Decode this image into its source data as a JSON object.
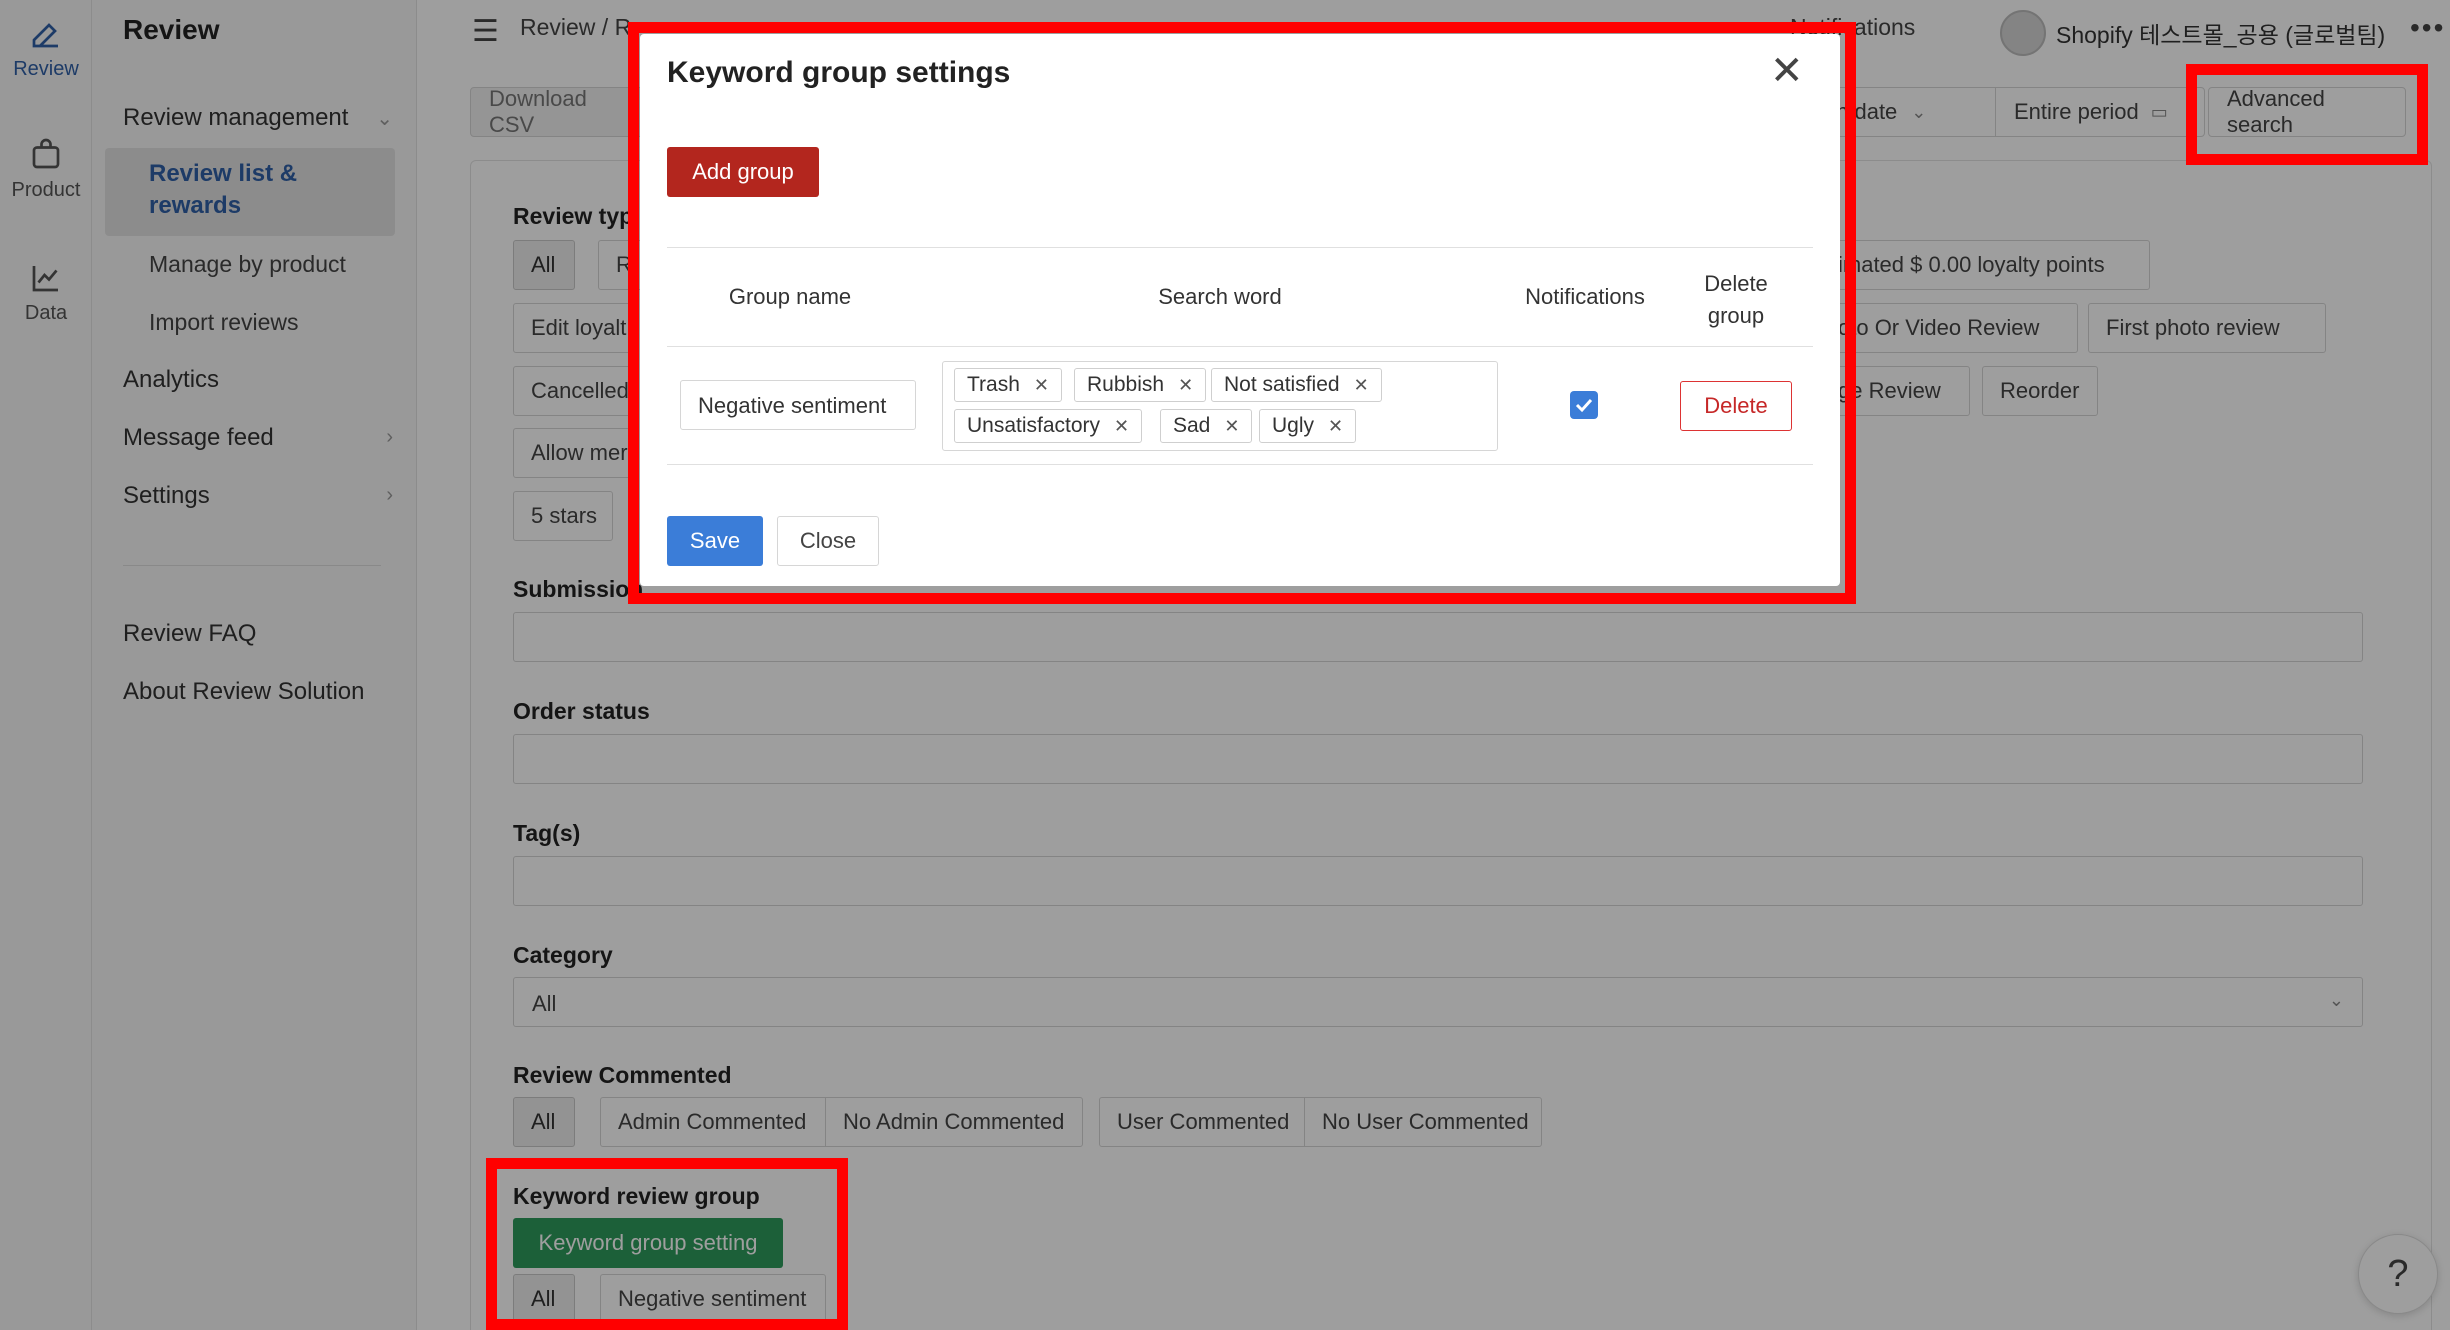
{
  "rail": {
    "items": [
      {
        "label": "Review",
        "icon": "edit-icon"
      },
      {
        "label": "Product",
        "icon": "bag-icon"
      },
      {
        "label": "Data",
        "icon": "chart-icon"
      }
    ]
  },
  "sidebar": {
    "title": "Review",
    "review_management": "Review management",
    "active_item": "Review list & rewards",
    "manage_by_product": "Manage by product",
    "import_reviews": "Import reviews",
    "analytics": "Analytics",
    "message_feed": "Message feed",
    "settings": "Settings",
    "review_faq": "Review FAQ",
    "about": "About Review Solution"
  },
  "topbar": {
    "breadcrumb": "Review  /  R",
    "notifications": "Notifications",
    "store_name": "Shopify 테스트몰_공용 (글로벌팀)",
    "more": "•••"
  },
  "toolbar": {
    "download_csv": "Download CSV",
    "submission_date": "ion date",
    "entire_period": "Entire period",
    "advanced_search": "Advanced search"
  },
  "filters": {
    "review_type_label": "Review typ",
    "chip_all": "All",
    "chip_r": "R",
    "edit_loyalty": "Edit loyalt",
    "cancelled": "Cancelled",
    "allow_mem": "Allow mer",
    "five_stars": "5 stars",
    "estimated_points": "imated $ 0.00 loyalty points",
    "photo_video": "oto Or Video Review",
    "first_photo": "First photo review",
    "ge_review": "ge Review",
    "reorder": "Reorder",
    "submission_label": "Submission",
    "order_status_label": "Order status",
    "tags_label": "Tag(s)",
    "category_label": "Category",
    "category_value": "All",
    "review_commented_label": "Review Commented",
    "rc_all": "All",
    "rc_admin": "Admin Commented",
    "rc_no_admin": "No Admin Commented",
    "rc_user": "User Commented",
    "rc_no_user": "No User Commented",
    "keyword_group_label": "Keyword review group",
    "keyword_group_setting": "Keyword group setting",
    "kg_all": "All",
    "kg_negative": "Negative sentiment"
  },
  "modal": {
    "title": "Keyword group settings",
    "add_group": "Add group",
    "col_group_name": "Group name",
    "col_search_word": "Search word",
    "col_notifications": "Notifications",
    "col_delete_line1": "Delete",
    "col_delete_line2": "group",
    "group_name_value": "Negative sentiment",
    "tags": [
      "Trash",
      "Rubbish",
      "Not satisfied",
      "Unsatisfactory",
      "Sad",
      "Ugly"
    ],
    "notifications_checked": true,
    "delete": "Delete",
    "save": "Save",
    "close": "Close"
  },
  "help": "?",
  "colors": {
    "annotation": "#ff0000",
    "primary_blue": "#3b7dd8",
    "danger_red": "#b3261e",
    "success_green": "#2e9b5c",
    "sidebar_active": "#2f5fa7"
  }
}
